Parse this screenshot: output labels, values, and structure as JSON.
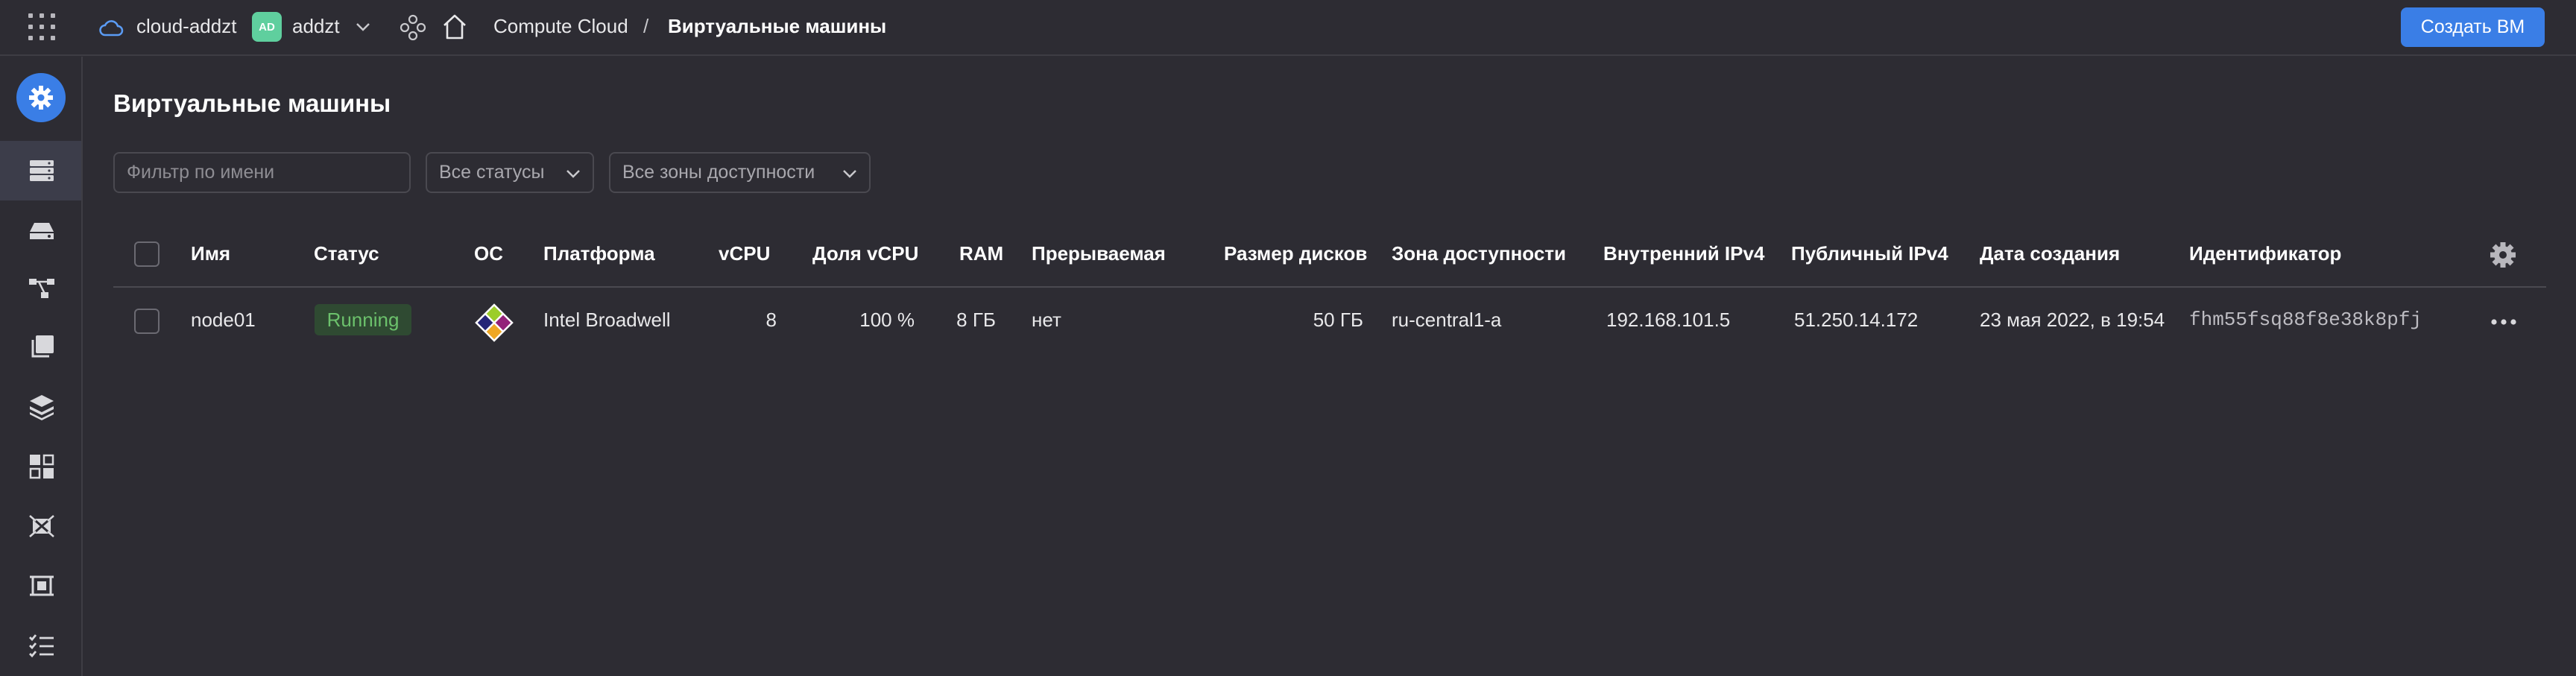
{
  "header": {
    "cloud_name": "cloud-addzt",
    "avatar_text": "AD",
    "folder_name": "addzt",
    "breadcrumb": {
      "service": "Compute Cloud",
      "separator": "/",
      "current": "Виртуальные машины"
    },
    "create_button": "Создать ВМ"
  },
  "sidebar": {
    "items": [
      {
        "icon": "compute-cloud-icon",
        "active_service": true
      },
      {
        "icon": "virtual-machines-icon",
        "active": true
      },
      {
        "icon": "disks-icon"
      },
      {
        "icon": "placement-groups-icon"
      },
      {
        "icon": "snapshots-icon"
      },
      {
        "icon": "images-icon"
      },
      {
        "icon": "instance-groups-icon"
      },
      {
        "icon": "file-storages-icon"
      },
      {
        "icon": "gpu-clusters-icon"
      },
      {
        "icon": "operations-icon"
      }
    ]
  },
  "main": {
    "title": "Виртуальные машины",
    "filter_placeholder": "Фильтр по имени",
    "status_filter": "Все статусы",
    "zone_filter": "Все зоны доступности"
  },
  "table": {
    "columns": {
      "name": "Имя",
      "status": "Статус",
      "os": "ОС",
      "platform": "Платформа",
      "vcpu": "vCPU",
      "vcpu_share": "Доля vCPU",
      "ram": "RAM",
      "preemptible": "Прерываемая",
      "disk_size": "Размер дисков",
      "zone": "Зона доступности",
      "internal_ip": "Внутренний IPv4",
      "public_ip": "Публичный IPv4",
      "created": "Дата создания",
      "id": "Идентификатор"
    },
    "rows": [
      {
        "name": "node01",
        "status": "Running",
        "os_icon": "centos-icon",
        "platform": "Intel Broadwell",
        "vcpu": "8",
        "vcpu_share": "100 %",
        "ram": "8 ГБ",
        "preemptible": "нет",
        "disk_size": "50 ГБ",
        "zone": "ru-central1-a",
        "internal_ip": "192.168.101.5",
        "public_ip": "51.250.14.172",
        "created": "23 мая 2022, в 19:54",
        "id": "fhm55fsq88f8e38k8pfj"
      }
    ]
  },
  "colors": {
    "background": "#2d2c33",
    "accent": "#3a7ee6",
    "status_running_text": "#6cc16c",
    "status_running_bg": "#2f4a32",
    "avatar_bg": "#5fcf9e"
  }
}
